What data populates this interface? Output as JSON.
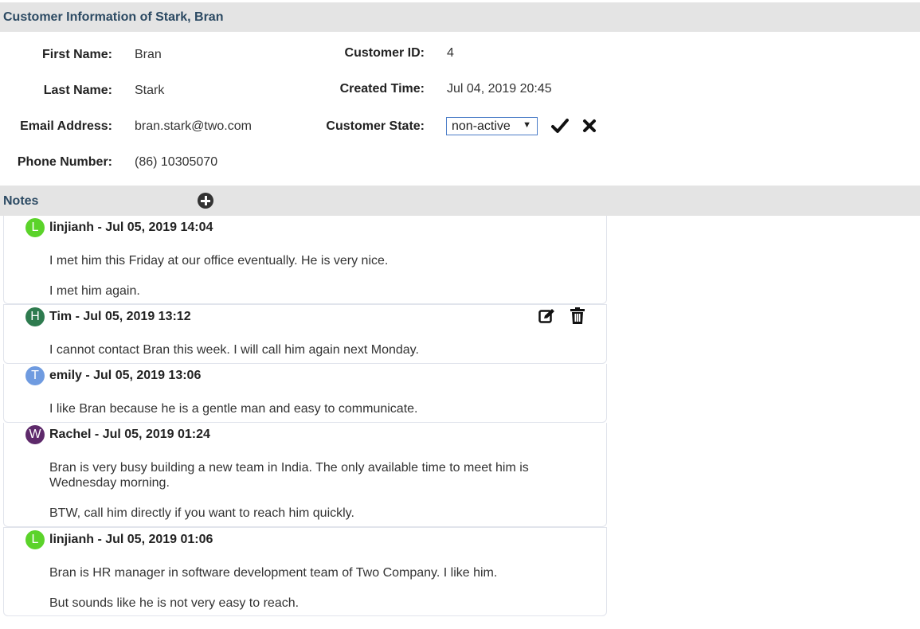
{
  "header": {
    "title": "Customer Information of Stark, Bran"
  },
  "customer": {
    "first_name_label": "First Name:",
    "first_name": "Bran",
    "last_name_label": "Last Name:",
    "last_name": "Stark",
    "email_label": "Email Address:",
    "email": "bran.stark@two.com",
    "phone_label": "Phone Number:",
    "phone": "(86) 10305070",
    "id_label": "Customer ID:",
    "id": "4",
    "created_label": "Created Time:",
    "created": "Jul 04, 2019 20:45",
    "state_label": "Customer State:",
    "state": "non-active"
  },
  "notes_section": {
    "title": "Notes"
  },
  "notes": [
    {
      "initial": "L",
      "color": "#5bd32a",
      "header": "linjianh - Jul 05, 2019 14:04",
      "paragraphs": [
        "I met him this Friday at our office eventually. He is very nice.",
        "I met him again."
      ]
    },
    {
      "initial": "H",
      "color": "#2e7b4f",
      "header": "Tim - Jul 05, 2019 13:12",
      "paragraphs": [
        "I cannot contact Bran this week. I will call him again next Monday."
      ]
    },
    {
      "initial": "T",
      "color": "#6f9be0",
      "header": "emily - Jul 05, 2019 13:06",
      "paragraphs": [
        "I like Bran because he is a gentle man and easy to communicate."
      ]
    },
    {
      "initial": "W",
      "color": "#5e2a6b",
      "header": "Rachel - Jul 05, 2019 01:24",
      "paragraphs": [
        "Bran is very busy building a new team in India. The only available time to meet him is Wednesday morning.",
        "BTW, call him directly if you want to reach him quickly."
      ]
    },
    {
      "initial": "L",
      "color": "#5bd32a",
      "header": "linjianh - Jul 05, 2019 01:06",
      "paragraphs": [
        "Bran is HR manager in software development team of Two Company. I like him.",
        "But sounds like he is not very easy to reach."
      ]
    }
  ]
}
